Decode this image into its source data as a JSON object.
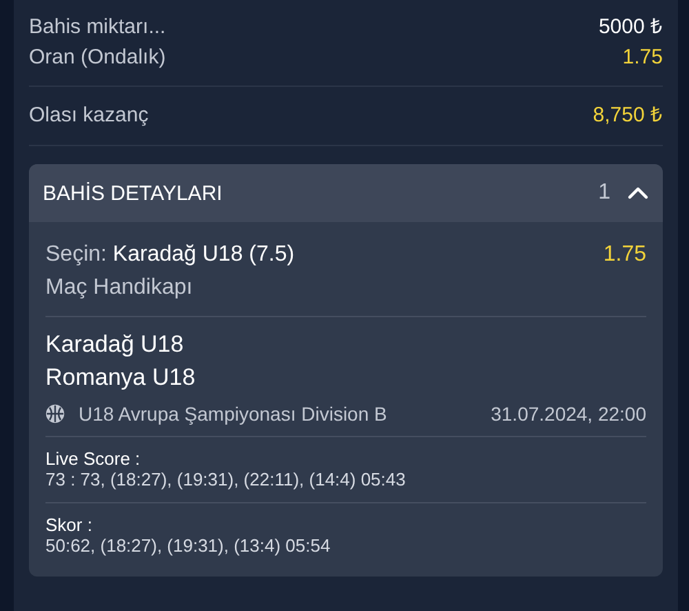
{
  "summary": [
    {
      "label": "Bahis miktarı...",
      "value": "5000 ₺",
      "highlight": false
    },
    {
      "label": "Oran (Ondalık)",
      "value": "1.75",
      "highlight": true
    }
  ],
  "potential_win": {
    "label": "Olası kazanç",
    "value": "8,750 ₺"
  },
  "details": {
    "title": "BAHİS DETAYLARI",
    "count": "1",
    "expanded": true,
    "selection": {
      "prefix": "Seçin:",
      "pick": "Karadağ U18 (7.5)",
      "odds": "1.75",
      "market": "Maç Handikapı"
    },
    "teams": [
      "Karadağ U18",
      "Romanya U18"
    ],
    "league": "U18 Avrupa Şampiyonası Division B",
    "datetime": "31.07.2024, 22:00",
    "scores": [
      {
        "label": "Live Score :",
        "value": "73 : 73, (18:27), (19:31), (22:11), (14:4) 05:43"
      },
      {
        "label": "Skor :",
        "value": "50:62, (18:27), (19:31), (13:4) 05:54"
      }
    ]
  }
}
